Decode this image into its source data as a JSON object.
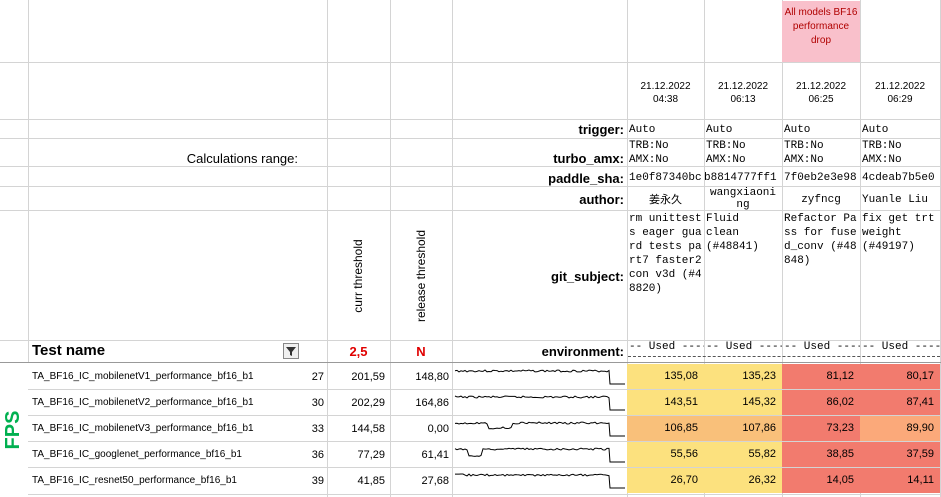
{
  "header": {
    "calc_range_label": "Calculations range:",
    "test_name_label": "Test name",
    "curr_threshold_label": "curr threshold",
    "release_threshold_label": "release threshold",
    "curr_threshold_value": "2,5",
    "release_threshold_value": "N",
    "note": "All models BF16 performance drop"
  },
  "row_labels": {
    "trigger": "trigger:",
    "turbo_amx": "turbo_amx:",
    "paddle_sha": "paddle_sha:",
    "author": "author:",
    "git_subject": "git_subject:",
    "environment": "environment:"
  },
  "commits": [
    {
      "date": "21.12.2022",
      "time": "04:38",
      "trigger": "Auto",
      "turbo1": "TRB:No",
      "turbo2": "AMX:No",
      "sha": "1e0f87340bc",
      "author": "姜永久",
      "subject": "rm unittests eager guard tests part7 faster2con v3d (#48820)",
      "env": "-- Used ----"
    },
    {
      "date": "21.12.2022",
      "time": "06:13",
      "trigger": "Auto",
      "turbo1": "TRB:No",
      "turbo2": "AMX:No",
      "sha": "b8814777ff1",
      "author": "wangxiaoni ng",
      "subject": "Fluid clean (#48841)",
      "env": "-- Used ----"
    },
    {
      "date": "21.12.2022",
      "time": "06:25",
      "trigger": "Auto",
      "turbo1": "TRB:No",
      "turbo2": "AMX:No",
      "sha": "7f0eb2e3e98",
      "author": "zyfncg",
      "subject": "Refactor Pass for fused_conv (#48848)",
      "env": "-- Used ----"
    },
    {
      "date": "21.12.2022",
      "time": "06:29",
      "trigger": "Auto",
      "turbo1": "TRB:No",
      "turbo2": "AMX:No",
      "sha": "4cdeab7b5e0",
      "author": "Yuanle Liu",
      "subject": "fix get trt weight (#49197)",
      "env": "-- Used ----"
    }
  ],
  "group_label": "FPS",
  "tests": [
    {
      "name": "TA_BF16_IC_mobilenetV1_performance_bf16_b1",
      "idx": "27",
      "curr": "201,59",
      "rel": "148,80",
      "vals": [
        "135,08",
        "135,23",
        "81,12",
        "80,17"
      ]
    },
    {
      "name": "TA_BF16_IC_mobilenetV2_performance_bf16_b1",
      "idx": "30",
      "curr": "202,29",
      "rel": "164,86",
      "vals": [
        "143,51",
        "145,32",
        "86,02",
        "87,41"
      ]
    },
    {
      "name": "TA_BF16_IC_mobilenetV3_performance_bf16_b1",
      "idx": "33",
      "curr": "144,58",
      "rel": "0,00",
      "vals": [
        "106,85",
        "107,86",
        "73,23",
        "89,90"
      ]
    },
    {
      "name": "TA_BF16_IC_googlenet_performance_bf16_b1",
      "idx": "36",
      "curr": "77,29",
      "rel": "61,41",
      "vals": [
        "55,56",
        "55,82",
        "38,85",
        "37,59"
      ]
    },
    {
      "name": "TA_BF16_IC_resnet50_performance_bf16_b1",
      "idx": "39",
      "curr": "41,85",
      "rel": "27,68",
      "vals": [
        "26,70",
        "26,32",
        "14,05",
        "14,11"
      ]
    }
  ],
  "colors": {
    "note_bg": "#f9c0cb",
    "green": "#00b050",
    "red": "#e00000",
    "heat": [
      [
        "#fce17e",
        "#fce17e",
        "#f27b6e",
        "#f27b6e"
      ],
      [
        "#fce17e",
        "#fce17e",
        "#f27b6e",
        "#f27b6e"
      ],
      [
        "#f9c07a",
        "#f9c07a",
        "#f27b6e",
        "#fba97a"
      ],
      [
        "#fce17e",
        "#fce17e",
        "#f27b6e",
        "#f27b6e"
      ],
      [
        "#fce17e",
        "#fce17e",
        "#f27b6e",
        "#f27b6e"
      ]
    ]
  }
}
